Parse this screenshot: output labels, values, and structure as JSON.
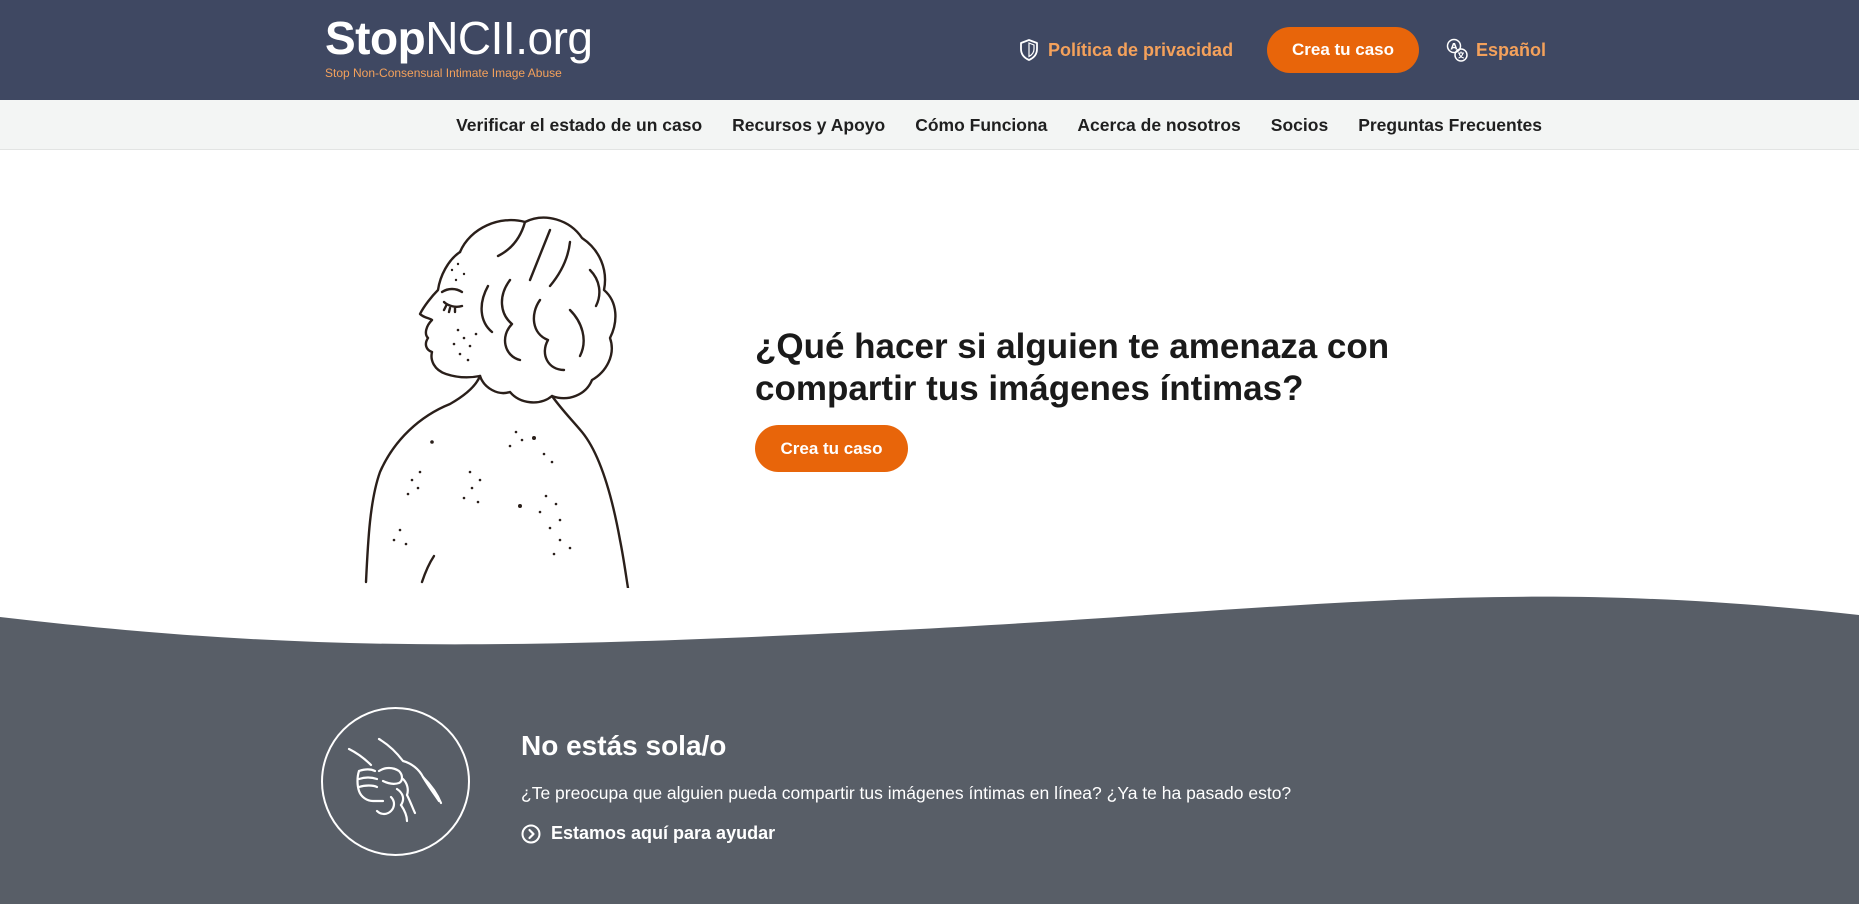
{
  "header": {
    "logo_bold": "Stop",
    "logo_light": "NCII.org",
    "logo_tagline": "Stop Non-Consensual Intimate Image Abuse",
    "privacy_label": "Política de privacidad",
    "privacy_icon": "shield-icon",
    "cta_label": "Crea tu caso",
    "language_label": "Español",
    "language_icon": "translate-icon"
  },
  "nav": {
    "items": [
      {
        "label": "Verificar el estado de un caso"
      },
      {
        "label": "Recursos y Apoyo"
      },
      {
        "label": "Cómo Funciona"
      },
      {
        "label": "Acerca de nosotros"
      },
      {
        "label": "Socios"
      },
      {
        "label": "Preguntas Frecuentes"
      }
    ]
  },
  "hero": {
    "title_part1": "¿Qué hacer si alguien te ",
    "title_bold": "amenaza con compartir",
    "title_part2": " tus imágenes íntimas?",
    "cta_label": "Crea tu caso"
  },
  "help": {
    "icon": "holding-hands-icon",
    "title": "No estás sola/o",
    "text": "¿Te preocupa que alguien pueda compartir tus imágenes íntimas en línea? ¿Ya te ha pasado esto?",
    "link_label": "Estamos aquí para ayudar",
    "link_icon": "chevron-right-circle-icon"
  },
  "colors": {
    "header_bg": "#3f4862",
    "accent_orange": "#e8650a",
    "link_orange": "#f4a15b",
    "nav_bg": "#f3f5f4",
    "band_bg": "#585e67"
  }
}
